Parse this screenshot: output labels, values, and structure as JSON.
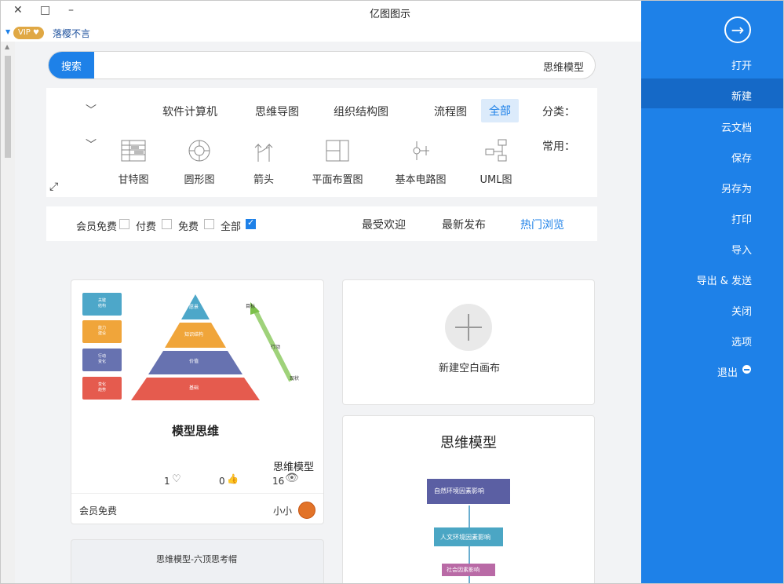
{
  "window": {
    "title": "亿图图示",
    "minimize": "–",
    "maximize": "□",
    "close": "✕"
  },
  "user": {
    "vip_badge": "VIP",
    "name": "落樱不言"
  },
  "side_menu": {
    "items": [
      "打开",
      "新建",
      "云文档",
      "保存",
      "另存为",
      "打印",
      "导入",
      "导出 & 发送",
      "关闭",
      "选项",
      "退出"
    ],
    "selected": "新建"
  },
  "search": {
    "button": "搜索",
    "value": "思维模型"
  },
  "categories": {
    "label": "分类：",
    "items": [
      "全部",
      "流程图",
      "组织结构图",
      "思维导图",
      "软件计算机"
    ],
    "selected": "全部"
  },
  "common": {
    "label": "常用：",
    "items": [
      "UML图",
      "基本电路图",
      "平面布置图",
      "箭头",
      "圆形图",
      "甘特图"
    ]
  },
  "sort_tabs": {
    "items": [
      "热门浏览",
      "最新发布",
      "最受欢迎"
    ],
    "selected": "热门浏览"
  },
  "price_filters": {
    "items": [
      "全部",
      "免费",
      "付费",
      "会员免费"
    ],
    "checked": "全部"
  },
  "blank_card": {
    "label": "新建空白画布"
  },
  "template_card": {
    "preview_title": "模型思维",
    "pyramid_levels": [
      "愿景",
      "知识结构",
      "价值",
      "基础"
    ],
    "side_boxes": [
      "关键\n结构",
      "能力\n建设",
      "行动\n变化",
      "变化\n趋势"
    ],
    "arrow_labels": [
      "目标",
      "行动",
      "现状"
    ],
    "name": "思维模型",
    "views": "16",
    "likes": "0",
    "favorites": "1",
    "author": "小小",
    "price": "会员免费"
  },
  "mind_card": {
    "title": "思维模型",
    "boxes": [
      "自然环境因素影响",
      "人文环境因素影响",
      "社会因素影响"
    ]
  },
  "partial_card": {
    "title": "思维模型-六顶思考帽"
  },
  "colors": {
    "accent": "#1e81e8",
    "side_selected": "#1569c7"
  }
}
